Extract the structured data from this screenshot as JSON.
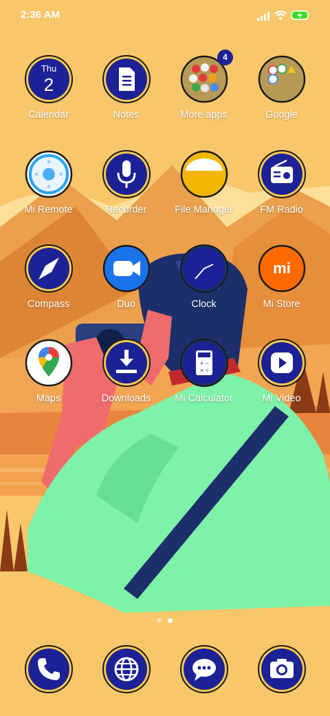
{
  "status_bar": {
    "time": "2:36 AM",
    "icons": [
      "signal-icon",
      "wifi-icon",
      "battery-charging-icon"
    ]
  },
  "apps": [
    {
      "label": "Calendar",
      "icon": "calendar-icon",
      "day": "Thu",
      "date": "2"
    },
    {
      "label": "Notes",
      "icon": "notes-icon"
    },
    {
      "label": "More apps",
      "icon": "folder-icon",
      "badge": "4"
    },
    {
      "label": "Google",
      "icon": "folder-icon"
    },
    {
      "label": "Mi Remote",
      "icon": "remote-icon"
    },
    {
      "label": "Recorder",
      "icon": "microphone-icon"
    },
    {
      "label": "File Manager",
      "icon": "folder-icon"
    },
    {
      "label": "FM Radio",
      "icon": "radio-icon"
    },
    {
      "label": "Compass",
      "icon": "compass-icon"
    },
    {
      "label": "Duo",
      "icon": "video-camera-icon"
    },
    {
      "label": "Clock",
      "icon": "clock-icon"
    },
    {
      "label": "Mi Store",
      "icon": "mi-logo-icon",
      "logo_text": "mi"
    },
    {
      "label": "Maps",
      "icon": "map-pin-icon"
    },
    {
      "label": "Downloads",
      "icon": "download-icon"
    },
    {
      "label": "Mi Calculator",
      "icon": "calculator-icon"
    },
    {
      "label": "Mi Video",
      "icon": "play-icon"
    }
  ],
  "dock": [
    {
      "icon": "phone-icon"
    },
    {
      "icon": "globe-icon"
    },
    {
      "icon": "messages-icon"
    },
    {
      "icon": "camera-icon"
    }
  ],
  "page_indicator": {
    "pages": 2,
    "current": 2
  },
  "colors": {
    "background": "#f8c76a",
    "icon_blue": "#1c2196",
    "ring_yellow": "#f6c94f",
    "mi_orange": "#ff6a00",
    "jacket_green": "#7ef2a8"
  }
}
